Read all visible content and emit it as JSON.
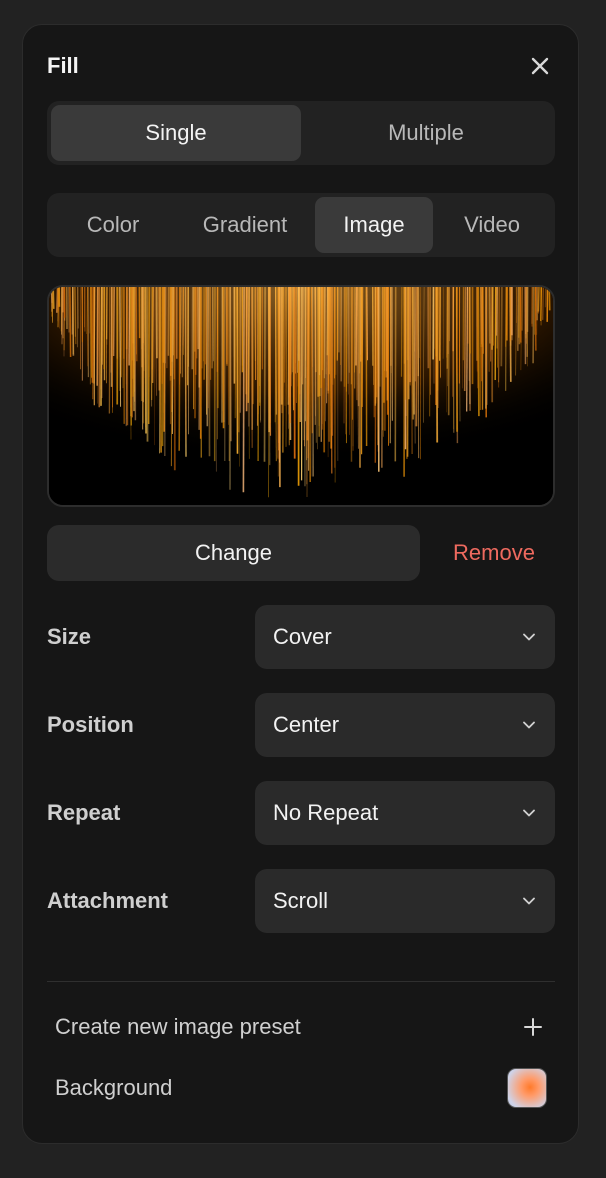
{
  "panel": {
    "title": "Fill",
    "close_icon": "close-icon"
  },
  "mode_tabs": [
    {
      "label": "Single",
      "active": true
    },
    {
      "label": "Multiple",
      "active": false
    }
  ],
  "type_tabs": [
    {
      "label": "Color",
      "active": false
    },
    {
      "label": "Gradient",
      "active": false
    },
    {
      "label": "Image",
      "active": true
    },
    {
      "label": "Video",
      "active": false
    }
  ],
  "image_actions": {
    "change_label": "Change",
    "remove_label": "Remove",
    "remove_color": "#ee6a5f"
  },
  "properties": [
    {
      "label": "Size",
      "value": "Cover"
    },
    {
      "label": "Position",
      "value": "Center"
    },
    {
      "label": "Repeat",
      "value": "No Repeat"
    },
    {
      "label": "Attachment",
      "value": "Scroll"
    }
  ],
  "footer": {
    "create_preset_label": "Create new image preset",
    "background_label": "Background",
    "plus_icon": "plus-icon"
  },
  "colors": {
    "panel_bg": "#161616",
    "control_bg": "#2a2a2a",
    "active_tab_bg": "#3a3a3a",
    "accent_orange": "#ff8a1c"
  }
}
